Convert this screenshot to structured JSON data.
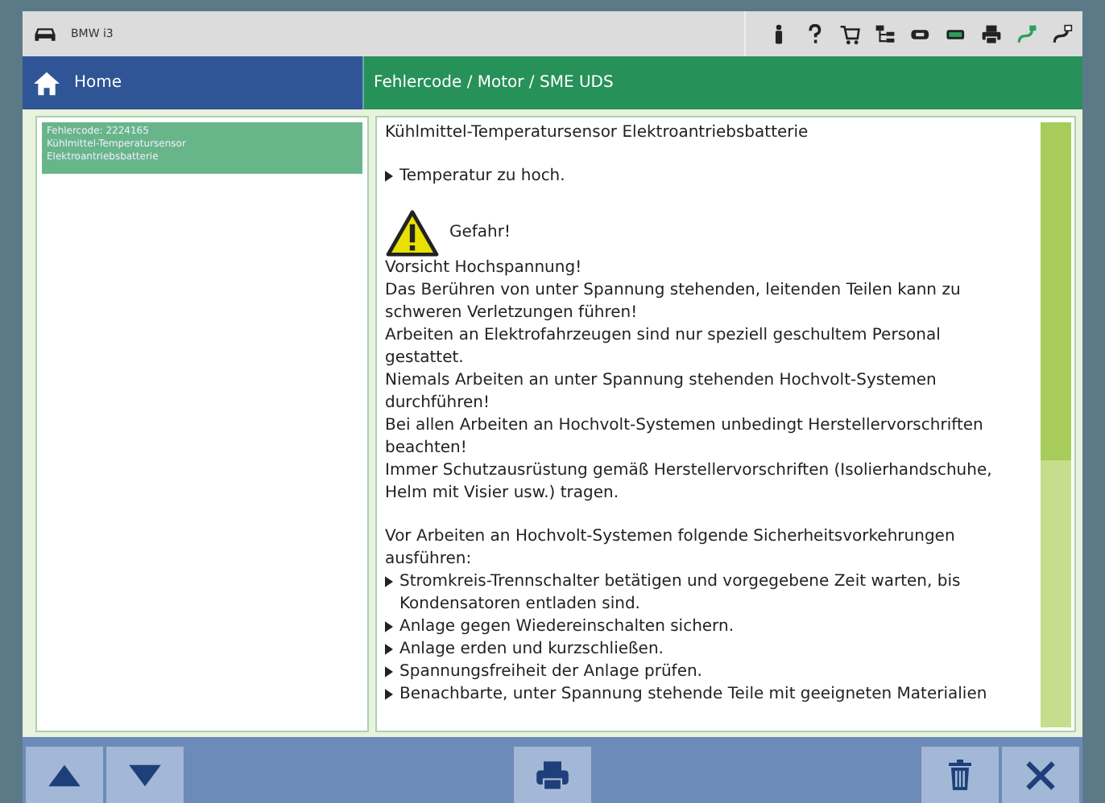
{
  "top_bar": {
    "vehicle": "BMW i3"
  },
  "nav": {
    "home": "Home",
    "breadcrumb": "Fehlercode / Motor / SME UDS"
  },
  "fault_list": [
    {
      "lines": [
        "Fehlercode: 2224165",
        "Kühlmittel-Temperatursensor",
        "Elektroantriebsbatterie"
      ],
      "selected": true
    }
  ],
  "sections": [
    {
      "lines": [
        {
          "kind": "title",
          "text": "Kühlmittel-Temperatursensor Elektroantriebsbatterie"
        }
      ]
    },
    {
      "lines": [
        {
          "kind": "bullet",
          "text": "Temperatur zu hoch."
        }
      ]
    },
    {
      "lines": [
        {
          "kind": "warning",
          "text": "Gefahr!"
        },
        {
          "kind": "line",
          "text": "Vorsicht Hochspannung!"
        },
        {
          "kind": "line",
          "text": "Das Berühren von unter Spannung stehenden, leitenden Teilen kann zu schweren Verletzungen führen!"
        },
        {
          "kind": "line",
          "text": "Arbeiten an Elektrofahrzeugen sind nur speziell geschultem Personal gestattet."
        },
        {
          "kind": "line",
          "text": "Niemals Arbeiten an unter Spannung stehenden Hochvolt-Systemen durchführen!"
        },
        {
          "kind": "line",
          "text": "Bei allen Arbeiten an Hochvolt-Systemen unbedingt Herstellervorschriften beachten!"
        },
        {
          "kind": "line",
          "text": "Immer Schutzausrüstung gemäß Herstellervorschriften (Isolierhandschuhe, Helm mit Visier usw.) tragen."
        }
      ]
    },
    {
      "lines": [
        {
          "kind": "line",
          "text": "Vor Arbeiten an Hochvolt-Systemen folgende Sicherheitsvorkehrungen ausführen:"
        },
        {
          "kind": "bullet",
          "text": "Stromkreis-Trennschalter betätigen und vorgegebene Zeit warten, bis Kondensatoren entladen sind."
        },
        {
          "kind": "bullet",
          "text": "Anlage gegen Wiedereinschalten sichern."
        },
        {
          "kind": "bullet",
          "text": "Anlage erden und kurzschließen."
        },
        {
          "kind": "bullet",
          "text": "Spannungsfreiheit der Anlage prüfen."
        },
        {
          "kind": "bullet",
          "text": "Benachbarte, unter Spannung stehende Teile mit geeigneten Materialien"
        }
      ]
    }
  ]
}
